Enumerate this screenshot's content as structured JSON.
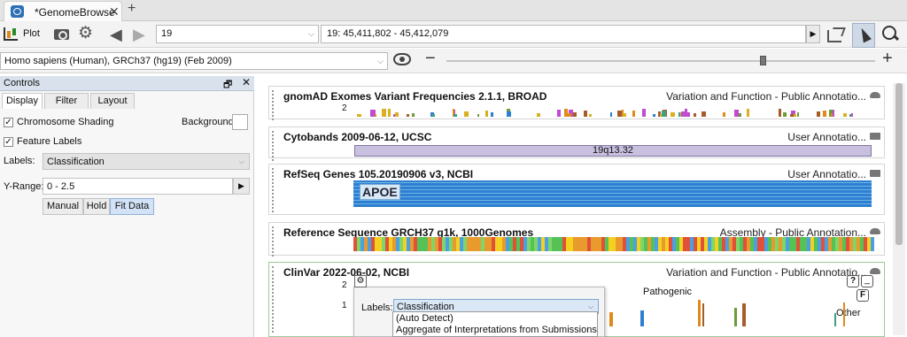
{
  "tab": {
    "title": "*GenomeBrowse",
    "close": "✕",
    "new": "+"
  },
  "toolbar": {
    "plot_label": "Plot",
    "chromosome": "19",
    "range": "19: 45,411,802 - 45,412,079"
  },
  "genome": {
    "label": "Homo sapiens (Human), GRCh37 (hg19) (Feb 2009)"
  },
  "controls": {
    "title": "Controls",
    "tabs": [
      "Display",
      "Filter",
      "Layout"
    ],
    "chromosome_shading": "Chromosome Shading",
    "background": "Background",
    "feature_labels": "Feature Labels",
    "labels_label": "Labels:",
    "labels_value": "Classification",
    "yrange_label": "Y-Range:",
    "yrange_value": "0 - 2.5",
    "buttons": [
      "Manual",
      "Hold",
      "Fit Data"
    ]
  },
  "tracks": {
    "gnomad": {
      "title": "gnomAD Exomes Variant Frequencies 2.1.1, BROAD",
      "source": "Variation and Function - Public Annotatio...",
      "ytick": "2"
    },
    "cytobands": {
      "title": "Cytobands 2009-06-12, UCSC",
      "source": "User Annotatio...",
      "band": "19q13.32"
    },
    "refseq": {
      "title": "RefSeq Genes 105.20190906 v3, NCBI",
      "source": "User Annotatio...",
      "gene": "APOE"
    },
    "reference": {
      "title": "Reference Sequence GRCH37 g1k, 1000Genomes",
      "source": "Assembly - Public Annotation..."
    },
    "clinvar": {
      "title": "ClinVar 2022-06-02, NCBI",
      "source": "Variation and Function - Public Annotatio...",
      "ytick_2": "2",
      "ytick_1": "1",
      "pathogenic": "Pathogenic",
      "other": "Other",
      "help": "?",
      "f": "F"
    }
  },
  "popup": {
    "labels": "Labels:",
    "value": "Classification",
    "options": [
      "(Auto Detect)",
      "Aggregate of Interpretations from Submissions"
    ]
  },
  "colors": {
    "accent": "#2d7fcf",
    "selected_tool": "#cfd9e6",
    "fit_data": "#d3e3f7"
  }
}
